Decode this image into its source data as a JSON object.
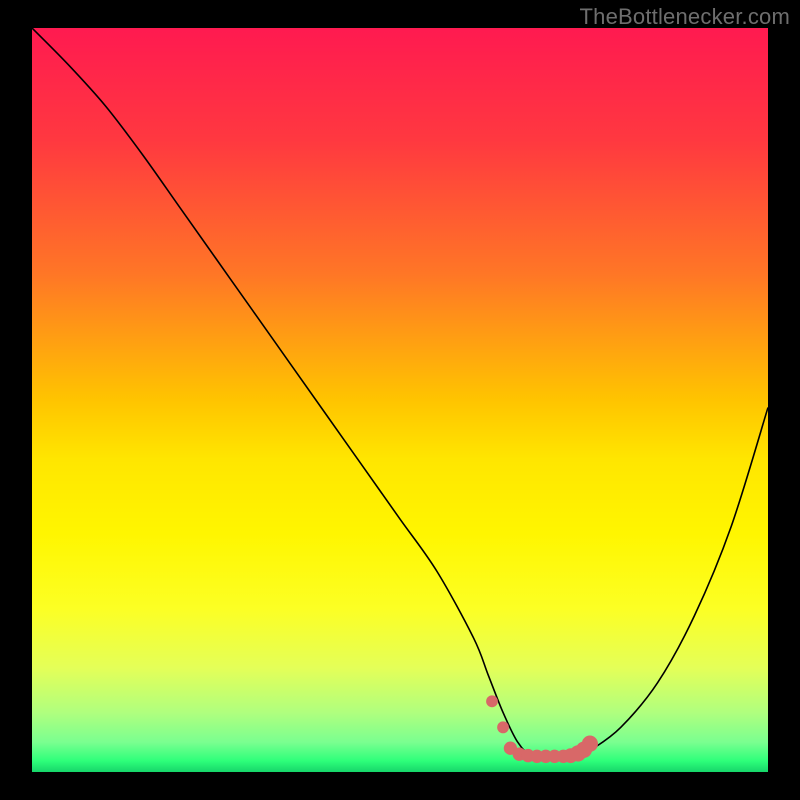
{
  "watermark": "TheBottlenecker.com",
  "chart_data": {
    "type": "line",
    "title": "",
    "xlabel": "",
    "ylabel": "",
    "xlim": [
      0,
      100
    ],
    "ylim": [
      0,
      100
    ],
    "background_gradient": {
      "stops": [
        {
          "offset": 0.0,
          "color": "#ff1a50"
        },
        {
          "offset": 0.15,
          "color": "#ff3840"
        },
        {
          "offset": 0.33,
          "color": "#ff7626"
        },
        {
          "offset": 0.5,
          "color": "#ffc400"
        },
        {
          "offset": 0.58,
          "color": "#ffe600"
        },
        {
          "offset": 0.68,
          "color": "#fff600"
        },
        {
          "offset": 0.78,
          "color": "#fcff24"
        },
        {
          "offset": 0.86,
          "color": "#e4ff58"
        },
        {
          "offset": 0.92,
          "color": "#b0ff7e"
        },
        {
          "offset": 0.96,
          "color": "#7aff90"
        },
        {
          "offset": 0.985,
          "color": "#2eff7a"
        },
        {
          "offset": 1.0,
          "color": "#16d66a"
        }
      ]
    },
    "series": [
      {
        "name": "curve",
        "color": "#000000",
        "x": [
          0,
          5,
          10,
          15,
          20,
          25,
          30,
          35,
          40,
          45,
          50,
          55,
          60,
          62,
          64,
          66,
          68,
          70,
          72,
          74,
          76,
          80,
          85,
          90,
          95,
          100
        ],
        "values": [
          100,
          95,
          89.5,
          83,
          76,
          69,
          62,
          55,
          48,
          41,
          34,
          27,
          18,
          13,
          8,
          4,
          2,
          2,
          2,
          2,
          3,
          6,
          12,
          21,
          33,
          49
        ]
      }
    ],
    "markers": {
      "name": "trough-dots",
      "color": "#d86868",
      "points": [
        {
          "x": 62.5,
          "y": 9.5,
          "r": 0.8
        },
        {
          "x": 64.0,
          "y": 6.0,
          "r": 0.8
        },
        {
          "x": 65.0,
          "y": 3.2,
          "r": 0.9
        },
        {
          "x": 66.2,
          "y": 2.4,
          "r": 0.9
        },
        {
          "x": 67.4,
          "y": 2.2,
          "r": 0.9
        },
        {
          "x": 68.6,
          "y": 2.1,
          "r": 0.9
        },
        {
          "x": 69.8,
          "y": 2.1,
          "r": 0.9
        },
        {
          "x": 71.0,
          "y": 2.1,
          "r": 0.9
        },
        {
          "x": 72.2,
          "y": 2.1,
          "r": 0.9
        },
        {
          "x": 73.2,
          "y": 2.2,
          "r": 1.0
        },
        {
          "x": 74.2,
          "y": 2.5,
          "r": 1.1
        },
        {
          "x": 75.0,
          "y": 3.0,
          "r": 1.1
        },
        {
          "x": 75.8,
          "y": 3.8,
          "r": 1.1
        }
      ]
    }
  }
}
